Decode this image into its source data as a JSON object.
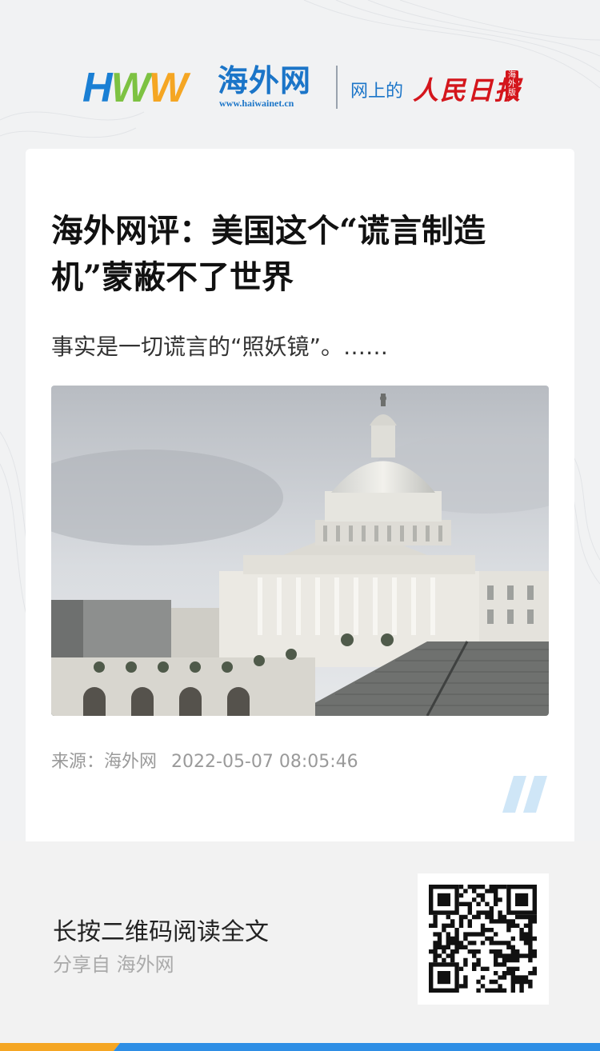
{
  "header": {
    "logo_letters": [
      "H",
      "W",
      "W"
    ],
    "logo_cn": "海外网",
    "logo_url": "www.haiwainet.cn",
    "online_label": "网上的",
    "rmrb_label": "人民日报",
    "overseas_badge": "海外版"
  },
  "article": {
    "title": "海外网评：美国这个“谎言制造机”蒙蔽不了世界",
    "summary": "事实是一切谎言的“照妖镜”。……",
    "source": "来源：海外网",
    "datetime": "2022-05-07 08:05:46"
  },
  "footer": {
    "cta": "长按二维码阅读全文",
    "share": "分享自 海外网"
  },
  "colors": {
    "brand_blue": "#1b75c8",
    "brand_green": "#7dc242",
    "brand_orange": "#f5a623",
    "rmrb_red": "#d4161c",
    "accent_stripe_blue": "#2e8ee5"
  },
  "icons": {
    "quote": "double-slash-quote-icon",
    "qr": "qr-code"
  }
}
